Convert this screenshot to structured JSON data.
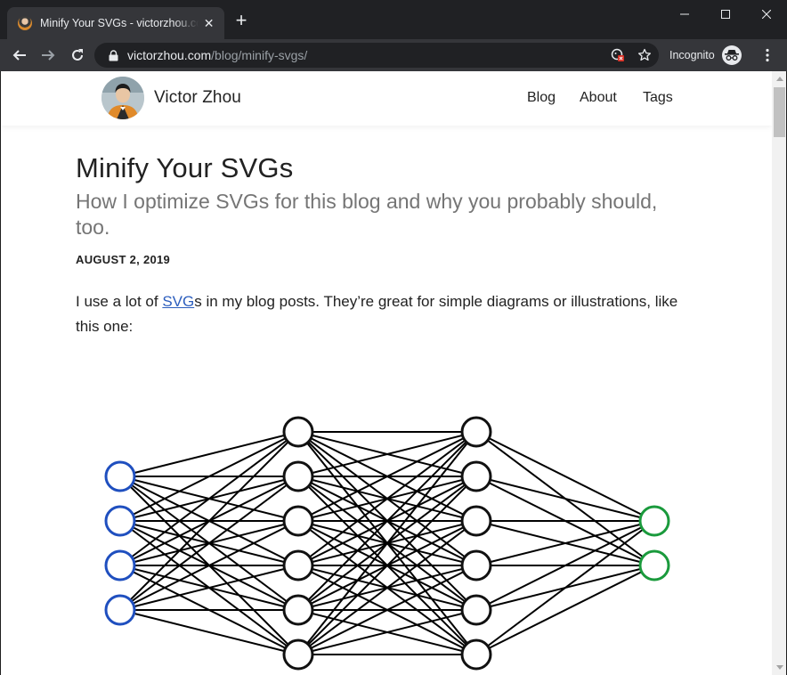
{
  "browser": {
    "tab": {
      "title": "Minify Your SVGs - victorzhou.com",
      "favicon": "avatar-favicon"
    },
    "new_tab_label": "+",
    "url": {
      "domain": "victorzhou.com",
      "path": "/blog/minify-svgs/"
    },
    "incognito_label": "Incognito"
  },
  "site": {
    "name": "Victor Zhou",
    "nav": [
      "Blog",
      "About",
      "Tags"
    ]
  },
  "post": {
    "title": "Minify Your SVGs",
    "subtitle": "How I optimize SVGs for this blog and why you probably should, too.",
    "date": "AUGUST 2, 2019",
    "intro_before": "I use a lot of ",
    "intro_link": "SVG",
    "intro_after": "s in my blog posts. They’re great for simple diagrams or illustrations, like this one:"
  },
  "diagram": {
    "layer_sizes": [
      4,
      6,
      6,
      2
    ],
    "layer_colors": [
      "#1f4fbf",
      "#111111",
      "#111111",
      "#1a9a3c"
    ]
  }
}
